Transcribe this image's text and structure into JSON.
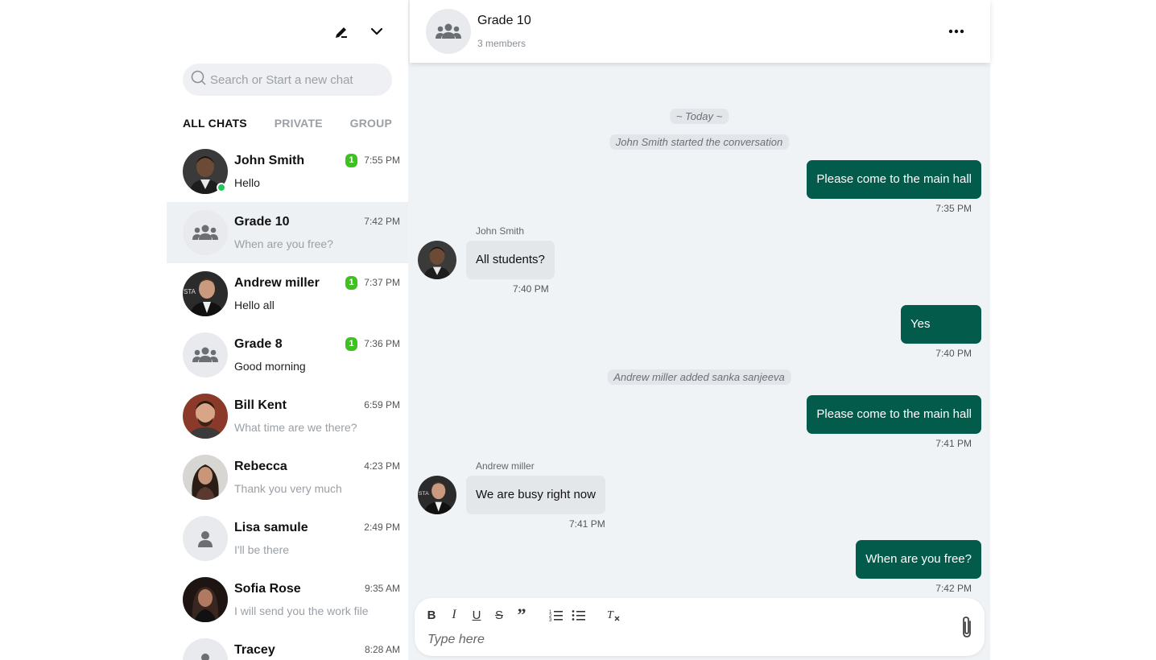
{
  "sidebar": {
    "search_placeholder": "Search or Start a new chat",
    "tabs": [
      "ALL CHATS",
      "PRIVATE",
      "GROUP"
    ],
    "chats": [
      {
        "name": "John Smith",
        "message": "Hello",
        "time": "7:55 PM",
        "badge": "1",
        "online": true,
        "avatar": "photo-john",
        "unread": true
      },
      {
        "name": "Grade 10",
        "message": "When are you free?",
        "time": "7:42 PM",
        "badge": "",
        "avatar": "group-icon",
        "unread": false,
        "selected": true
      },
      {
        "name": "Andrew miller",
        "message": "Hello all",
        "time": "7:37 PM",
        "badge": "1",
        "avatar": "photo-andrew",
        "unread": true
      },
      {
        "name": "Grade 8",
        "message": "Good morning",
        "time": "7:36 PM",
        "badge": "1",
        "avatar": "group-icon",
        "unread": true
      },
      {
        "name": "Bill Kent",
        "message": "What time are we there?",
        "time": "6:59 PM",
        "badge": "",
        "avatar": "photo-bill",
        "unread": false
      },
      {
        "name": "Rebecca",
        "message": "Thank you very much",
        "time": "4:23 PM",
        "badge": "",
        "avatar": "photo-rebecca",
        "unread": false
      },
      {
        "name": "Lisa samule",
        "message": "I'll be there",
        "time": "2:49 PM",
        "badge": "",
        "avatar": "user-icon",
        "unread": false
      },
      {
        "name": "Sofia Rose",
        "message": "I will send you the work file",
        "time": "9:35 AM",
        "badge": "",
        "avatar": "photo-sofia",
        "unread": false
      },
      {
        "name": "Tracey",
        "message": "",
        "time": "8:28 AM",
        "badge": "",
        "avatar": "user-icon",
        "unread": false
      }
    ]
  },
  "header": {
    "title": "Grade 10",
    "subtitle": "3 members"
  },
  "messages": {
    "date_divider": "~ Today ~",
    "system_started": "John Smith started the conversation",
    "out1": {
      "text": "Please come to the main hall",
      "time": "7:35 PM"
    },
    "in1": {
      "sender": "John Smith",
      "text": "All students?",
      "time": "7:40 PM"
    },
    "out2": {
      "text": "Yes",
      "time": "7:40 PM"
    },
    "system_added": "Andrew miller added sanka sanjeeva",
    "out3": {
      "text": "Please come to the main hall",
      "time": "7:41 PM"
    },
    "in2": {
      "sender": "Andrew miller",
      "text": "We are busy right now",
      "time": "7:41 PM"
    },
    "out4": {
      "text": "When are you free?",
      "time": "7:42 PM"
    }
  },
  "composer": {
    "placeholder": "Type here",
    "toolbar": [
      "bold",
      "italic",
      "underline",
      "strikethrough",
      "quote",
      "numbered-list",
      "bulleted-list",
      "clear-format"
    ]
  },
  "colors": {
    "accent": "#035c4b",
    "badge": "#3ec21f",
    "online": "#22c55e",
    "chat_bg": "#f0f3f6"
  }
}
